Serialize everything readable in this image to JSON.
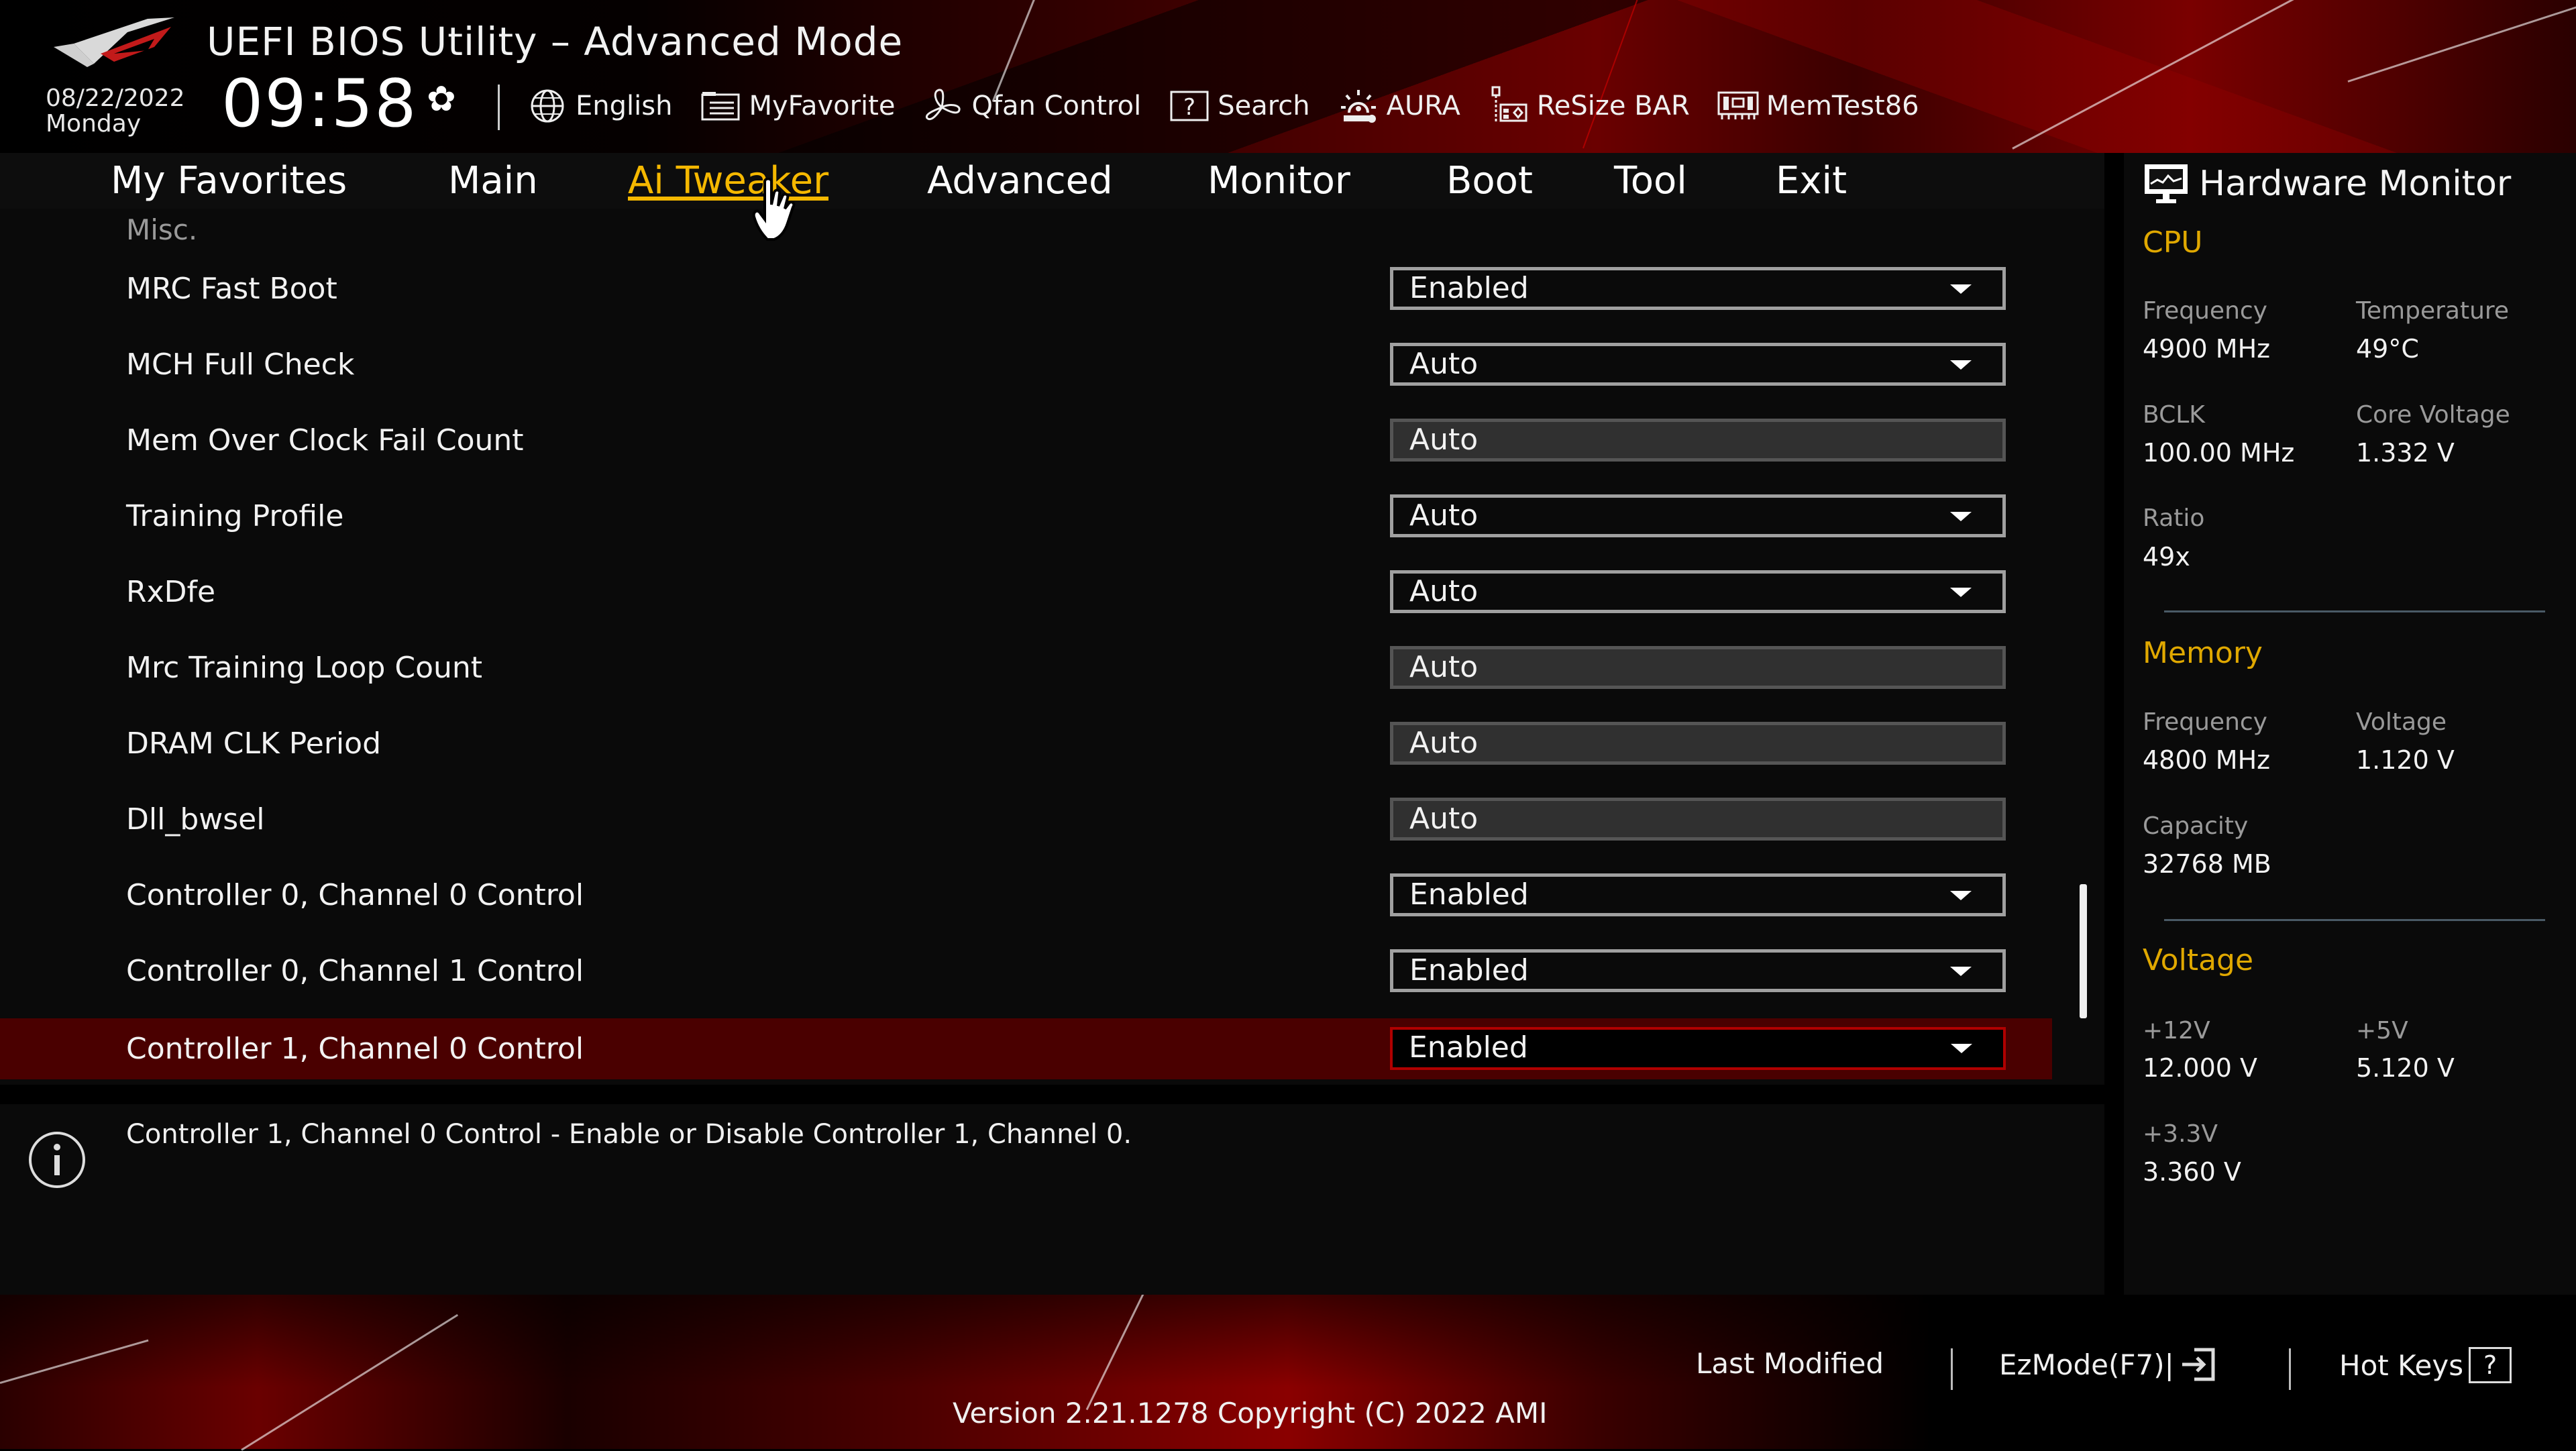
{
  "header": {
    "title": "UEFI BIOS Utility – Advanced Mode",
    "date": "08/22/2022",
    "day": "Monday",
    "time": "09:58",
    "toolbar": [
      {
        "label": "English",
        "icon": "globe-icon"
      },
      {
        "label": "MyFavorite",
        "icon": "favorite-list-icon"
      },
      {
        "label": "Qfan Control",
        "icon": "fan-icon"
      },
      {
        "label": "Search",
        "icon": "search-help-icon"
      },
      {
        "label": "AURA",
        "icon": "aura-light-icon"
      },
      {
        "label": "ReSize BAR",
        "icon": "pcie-card-icon"
      },
      {
        "label": "MemTest86",
        "icon": "memory-module-icon"
      }
    ]
  },
  "nav": {
    "tabs": [
      {
        "label": "My Favorites",
        "active": false
      },
      {
        "label": "Main",
        "active": false
      },
      {
        "label": "Ai Tweaker",
        "active": true
      },
      {
        "label": "Advanced",
        "active": false
      },
      {
        "label": "Monitor",
        "active": false
      },
      {
        "label": "Boot",
        "active": false
      },
      {
        "label": "Tool",
        "active": false
      },
      {
        "label": "Exit",
        "active": false
      }
    ]
  },
  "settings": {
    "section": "Misc.",
    "rows": [
      {
        "label": "MRC Fast Boot",
        "value": "Enabled",
        "type": "dropdown"
      },
      {
        "label": "MCH Full Check",
        "value": "Auto",
        "type": "dropdown"
      },
      {
        "label": "Mem Over Clock Fail Count",
        "value": "Auto",
        "type": "text"
      },
      {
        "label": "Training Profile",
        "value": "Auto",
        "type": "dropdown"
      },
      {
        "label": "RxDfe",
        "value": "Auto",
        "type": "dropdown"
      },
      {
        "label": "Mrc Training Loop Count",
        "value": "Auto",
        "type": "text"
      },
      {
        "label": "DRAM CLK Period",
        "value": "Auto",
        "type": "text"
      },
      {
        "label": "Dll_bwsel",
        "value": "Auto",
        "type": "text"
      },
      {
        "label": "Controller 0, Channel 0 Control",
        "value": "Enabled",
        "type": "dropdown"
      },
      {
        "label": "Controller 0, Channel 1 Control",
        "value": "Enabled",
        "type": "dropdown"
      },
      {
        "label": "Controller 1, Channel 0 Control",
        "value": "Enabled",
        "type": "dropdown",
        "selected": true
      }
    ]
  },
  "help": {
    "text": "Controller 1, Channel 0 Control - Enable or Disable Controller 1, Channel 0."
  },
  "hardware_monitor": {
    "title": "Hardware Monitor",
    "cpu": {
      "heading": "CPU",
      "frequency_label": "Frequency",
      "frequency": "4900 MHz",
      "temperature_label": "Temperature",
      "temperature": "49°C",
      "bclk_label": "BCLK",
      "bclk": "100.00 MHz",
      "core_voltage_label": "Core Voltage",
      "core_voltage": "1.332 V",
      "ratio_label": "Ratio",
      "ratio": "49x"
    },
    "memory": {
      "heading": "Memory",
      "frequency_label": "Frequency",
      "frequency": "4800 MHz",
      "voltage_label": "Voltage",
      "voltage": "1.120 V",
      "capacity_label": "Capacity",
      "capacity": "32768 MB"
    },
    "voltage": {
      "heading": "Voltage",
      "v12_label": "+12V",
      "v12": "12.000 V",
      "v5_label": "+5V",
      "v5": "5.120 V",
      "v33_label": "+3.3V",
      "v33": "3.360 V"
    }
  },
  "footer": {
    "last_modified": "Last Modified",
    "ezmode": "EzMode(F7)|",
    "hotkeys": "Hot Keys",
    "hotkeys_glyph": "?",
    "version": "Version 2.21.1278 Copyright (C) 2022 AMI"
  },
  "colors": {
    "accent": "#f5b800",
    "selection": "#4a0000",
    "selection_border": "#b00000"
  }
}
